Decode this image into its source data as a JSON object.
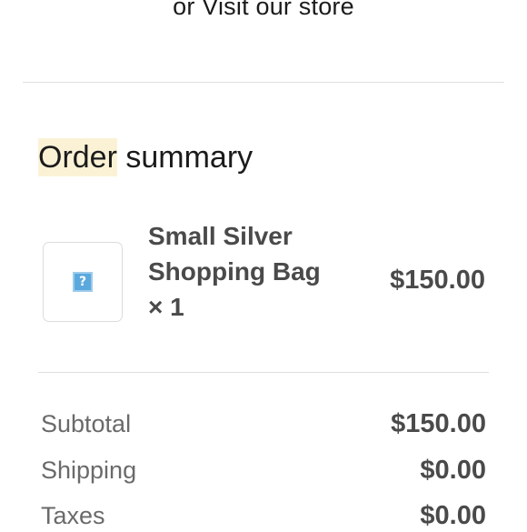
{
  "header": {
    "prefix": "or",
    "link_text": "Visit our store"
  },
  "summary": {
    "title_highlight": "Order",
    "title_rest": " summary"
  },
  "item": {
    "image_icon": "broken-image-icon",
    "image_glyph": "?",
    "name": "Small Silver Shopping Bag × 1",
    "price": "$150.00"
  },
  "totals": {
    "subtotal_label": "Subtotal",
    "subtotal_value": "$150.00",
    "shipping_label": "Shipping",
    "shipping_value": "$0.00",
    "taxes_label": "Taxes",
    "taxes_value": "$0.00"
  },
  "colors": {
    "highlight": "#fbf2d6",
    "divider": "#e1e1e1",
    "muted_text": "#6a6a6a",
    "strong_text": "#4a4a4a"
  }
}
